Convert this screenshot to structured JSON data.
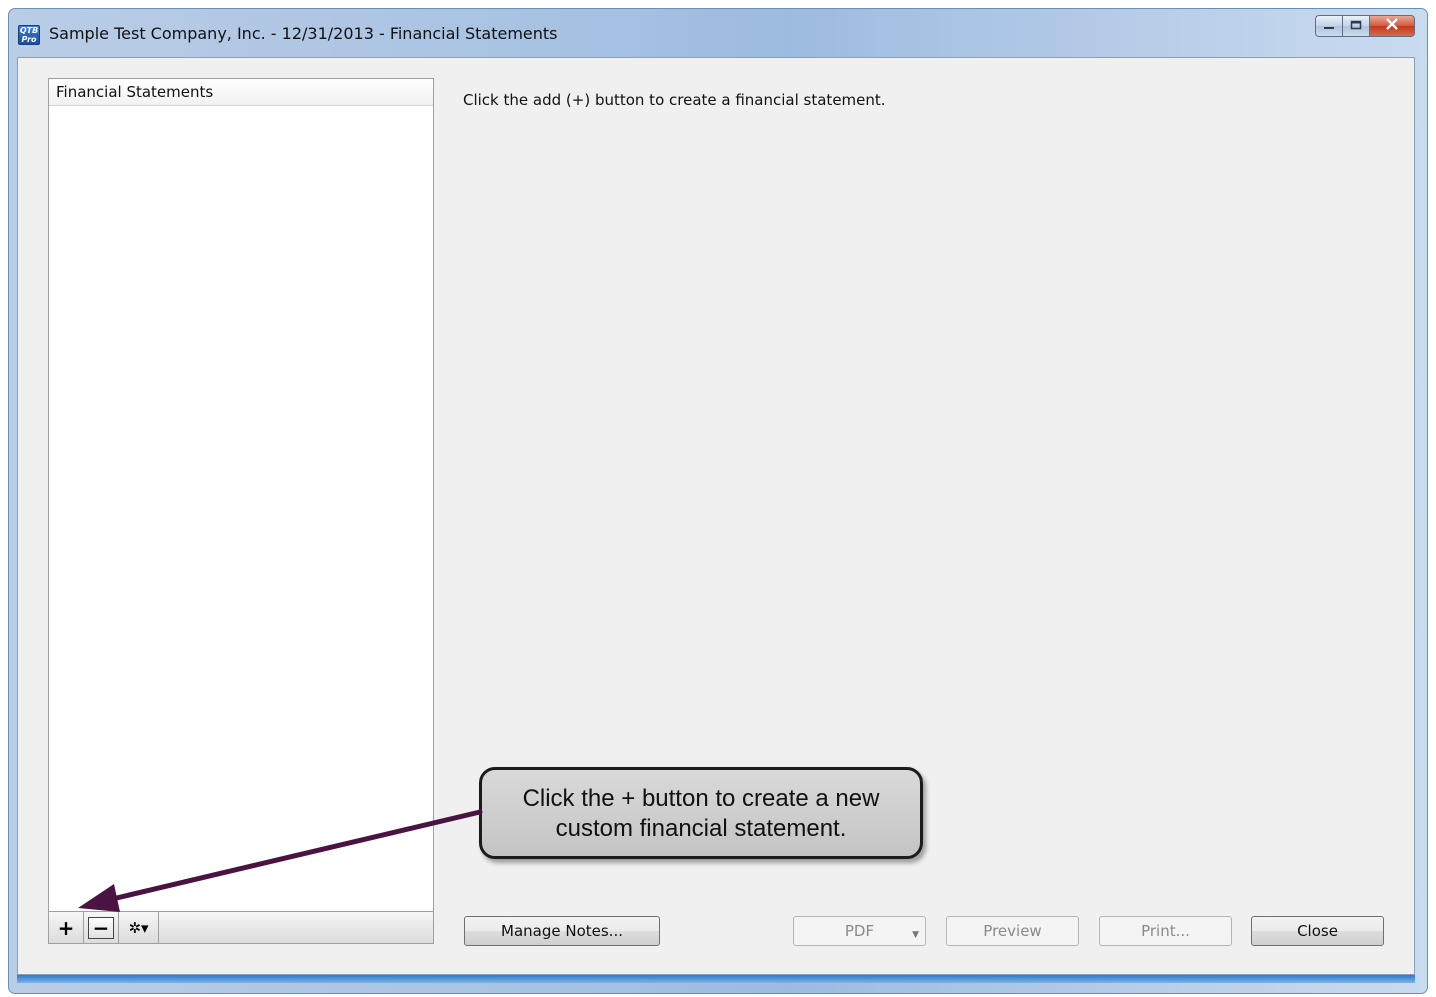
{
  "window": {
    "title": "Sample Test Company, Inc. - 12/31/2013 - Financial Statements",
    "app_icon_text": "QTB Pro",
    "controls": [
      "minimize",
      "maximize",
      "close"
    ]
  },
  "list_panel": {
    "header": "Financial Statements",
    "items": []
  },
  "list_toolbar": {
    "add_label": "+",
    "remove_label": "−",
    "gear_label": "✲▾"
  },
  "main": {
    "instruction": "Click the add (+) button to create a financial statement."
  },
  "buttons": {
    "manage_notes": "Manage Notes...",
    "pdf": "PDF",
    "preview": "Preview",
    "print": "Print...",
    "close": "Close"
  },
  "callout": {
    "line1": "Click the + button to create a new",
    "line2": "custom financial statement.",
    "arrow_color": "#4b1342"
  },
  "icons": {
    "minimize": "minimize-icon",
    "maximize": "maximize-icon",
    "close": "close-icon",
    "gear": "gear-icon",
    "dropdown": "chevron-down-icon"
  }
}
